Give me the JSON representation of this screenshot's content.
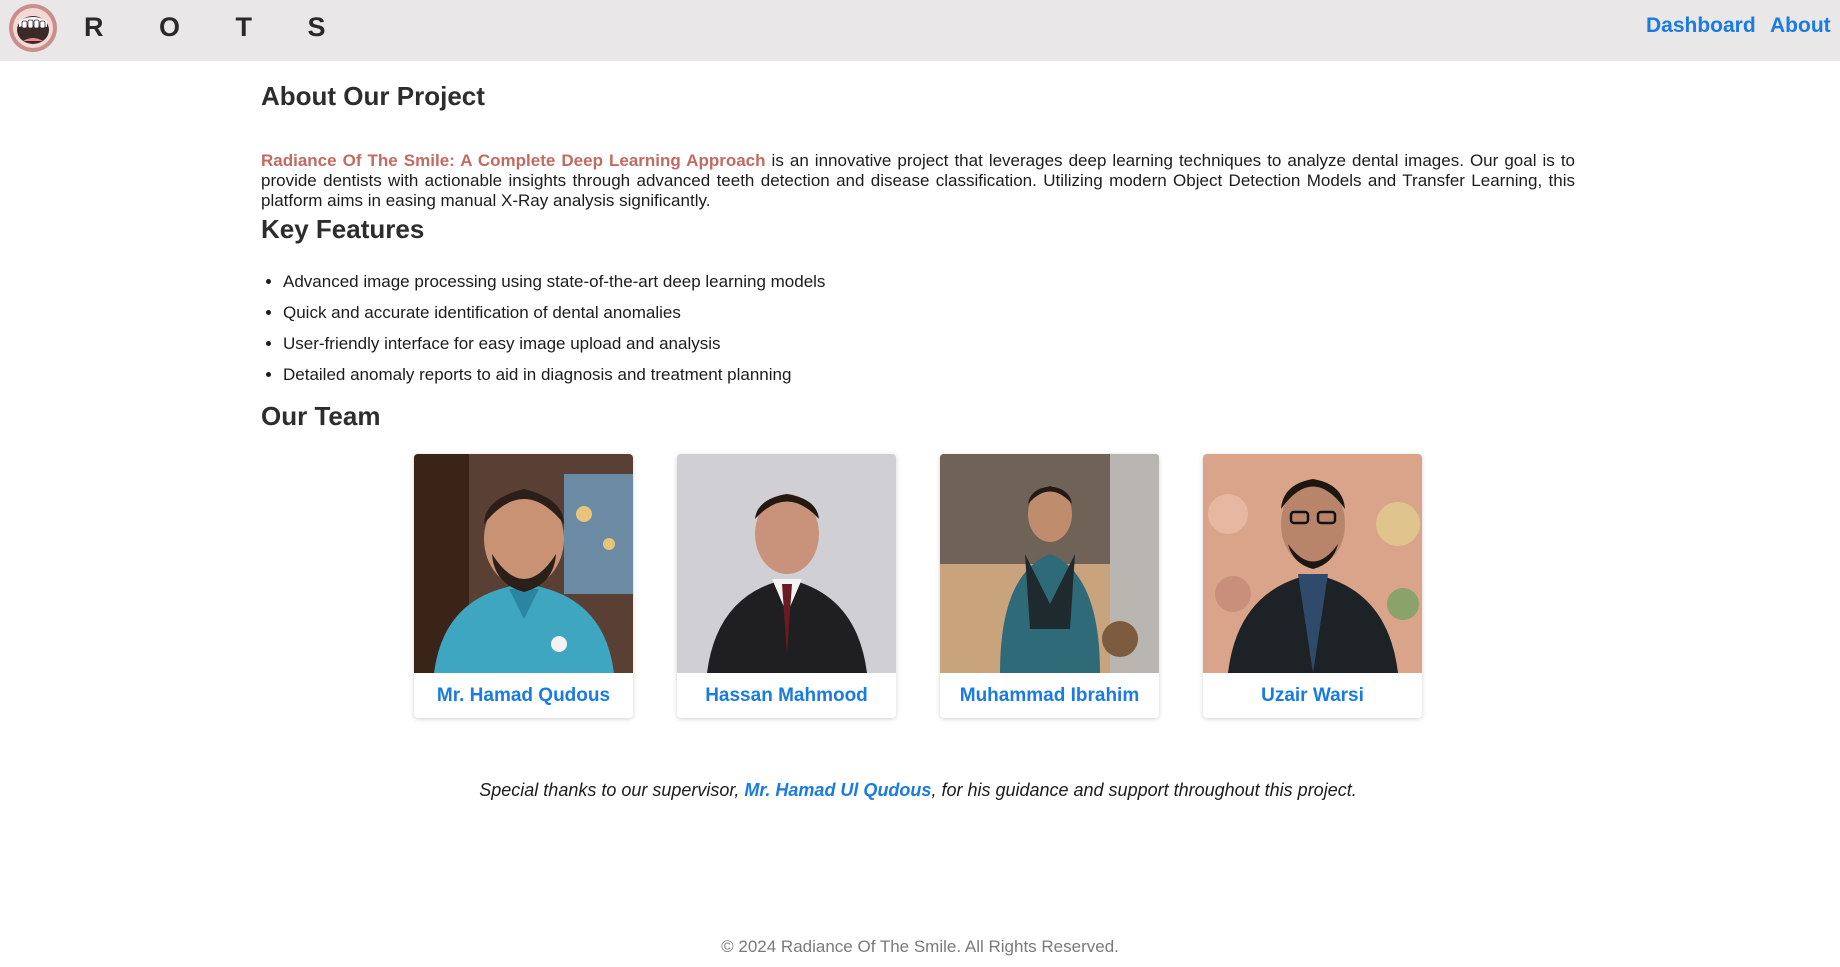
{
  "nav": {
    "brand": "R O T S",
    "links": [
      "Dashboard",
      "About"
    ]
  },
  "about": {
    "heading": "About Our Project",
    "project_name": "Radiance Of The Smile: A Complete Deep Learning Approach",
    "description": " is an innovative project that leverages deep learning techniques to analyze dental images. Our goal is to provide dentists with actionable insights through advanced teeth detection and disease classification. Utilizing modern Object Detection Models and Transfer Learning, this platform aims in easing manual X-Ray analysis significantly."
  },
  "features": {
    "heading": "Key Features",
    "items": [
      "Advanced image processing using state-of-the-art deep learning models",
      "Quick and accurate identification of dental anomalies",
      "User-friendly interface for easy image upload and analysis",
      "Detailed anomaly reports to aid in diagnosis and treatment planning"
    ]
  },
  "team": {
    "heading": "Our Team",
    "members": [
      {
        "name": "Mr. Hamad Qudous"
      },
      {
        "name": "Hassan Mahmood"
      },
      {
        "name": "Muhammad Ibrahim"
      },
      {
        "name": "Uzair Warsi"
      }
    ]
  },
  "thanks": {
    "prefix": "Special thanks to our supervisor, ",
    "supervisor": "Mr. Hamad Ul Qudous",
    "suffix": ", for his guidance and support throughout this project."
  },
  "footer": {
    "text": "© 2024 Radiance Of The Smile. All Rights Reserved."
  },
  "colors": {
    "navbar_bg": "#e9e7e8",
    "link": "#1a7be0",
    "project_name": "#c36a62"
  }
}
